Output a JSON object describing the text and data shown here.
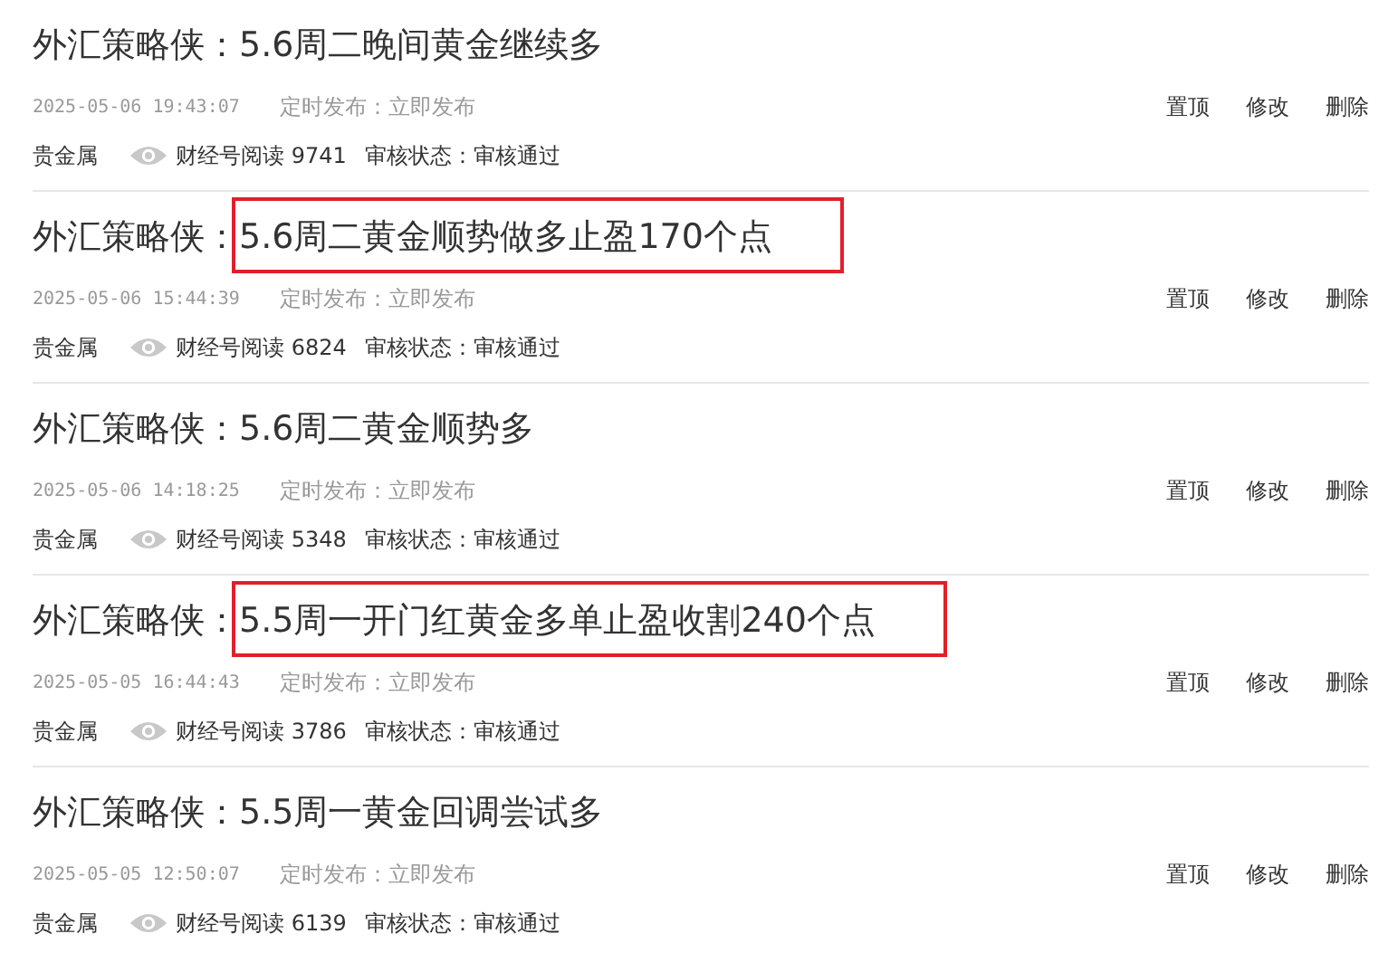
{
  "articles": [
    {
      "title": "外汇策略侠：5.6周二晚间黄金继续多",
      "time": "2025-05-06 19:43:07",
      "schedule": "定时发布：立即发布",
      "category": "贵金属",
      "reads": "财经号阅读 9741",
      "review": "审核状态：审核通过",
      "actions": [
        "置顶",
        "修改",
        "删除"
      ],
      "highlighted": false
    },
    {
      "title": "外汇策略侠：5.6周二黄金顺势做多止盈170个点",
      "time": "2025-05-06 15:44:39",
      "schedule": "定时发布：立即发布",
      "category": "贵金属",
      "reads": "财经号阅读 6824",
      "review": "审核状态：审核通过",
      "actions": [
        "置顶",
        "修改",
        "删除"
      ],
      "highlighted": true
    },
    {
      "title": "外汇策略侠：5.6周二黄金顺势多",
      "time": "2025-05-06 14:18:25",
      "schedule": "定时发布：立即发布",
      "category": "贵金属",
      "reads": "财经号阅读 5348",
      "review": "审核状态：审核通过",
      "actions": [
        "置顶",
        "修改",
        "删除"
      ],
      "highlighted": false
    },
    {
      "title": "外汇策略侠：5.5周一开门红黄金多单止盈收割240个点",
      "time": "2025-05-05 16:44:43",
      "schedule": "定时发布：立即发布",
      "category": "贵金属",
      "reads": "财经号阅读 3786",
      "review": "审核状态：审核通过",
      "actions": [
        "置顶",
        "修改",
        "删除"
      ],
      "highlighted": true
    },
    {
      "title": "外汇策略侠：5.5周一黄金回调尝试多",
      "time": "2025-05-05 12:50:07",
      "schedule": "定时发布：立即发布",
      "category": "贵金属",
      "reads": "财经号阅读 6139",
      "review": "审核状态：审核通过",
      "actions": [
        "置顶",
        "修改",
        "删除"
      ],
      "highlighted": false
    }
  ]
}
